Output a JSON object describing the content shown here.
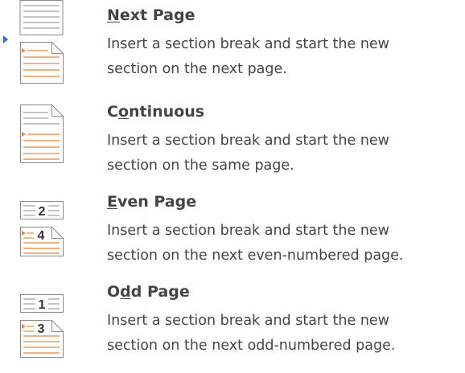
{
  "section_breaks": {
    "items": [
      {
        "id": "next-page",
        "title_pre": "",
        "title_key": "N",
        "title_post": "ext Page",
        "desc_line1": "Insert a section break and start the new",
        "desc_line2": "section on the next page.",
        "icon": "next-page-icon",
        "selected": true
      },
      {
        "id": "continuous",
        "title_pre": "C",
        "title_key": "o",
        "title_post": "ntinuous",
        "desc_line1": "Insert a section break and start the new",
        "desc_line2": "section on the same page.",
        "icon": "continuous-icon",
        "selected": false
      },
      {
        "id": "even-page",
        "title_pre": "",
        "title_key": "E",
        "title_post": "ven Page",
        "desc_line1": "Insert a section break and start the new",
        "desc_line2": "section on the next even-numbered page.",
        "icon": "even-page-icon",
        "icon_top_number": "2",
        "icon_bottom_number": "4",
        "selected": false
      },
      {
        "id": "odd-page",
        "title_pre": "O",
        "title_key": "d",
        "title_post": "d Page",
        "desc_line1": "Insert a section break and start the new",
        "desc_line2": "section on the next odd-numbered page.",
        "icon": "odd-page-icon",
        "icon_top_number": "1",
        "icon_bottom_number": "3",
        "selected": false
      }
    ]
  },
  "colors": {
    "text": "#444444",
    "icon_gray": "#8a8a8a",
    "icon_orange": "#e8883a",
    "selection": "#2a6fcf"
  }
}
